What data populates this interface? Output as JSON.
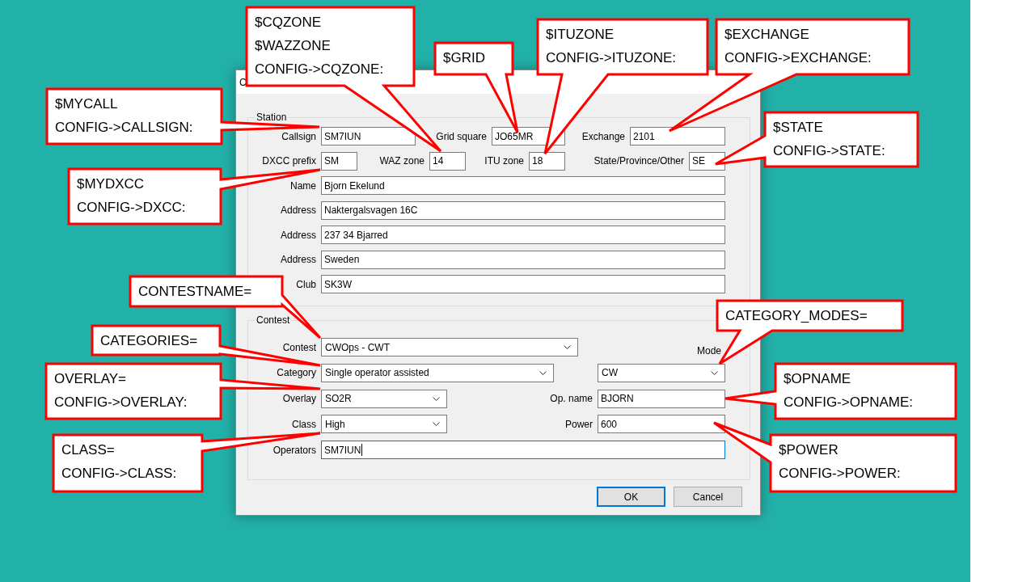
{
  "dialog": {
    "title": "C",
    "station": {
      "title": "Station",
      "fields": [
        {
          "kind": "text",
          "label": "Callsign",
          "value": "SM7IUN",
          "focused": false
        },
        {
          "kind": "text",
          "label": "Grid square",
          "value": "JO65MR",
          "focused": false
        },
        {
          "kind": "text",
          "label": "Exchange",
          "value": "2101",
          "focused": false
        },
        {
          "kind": "text",
          "label": "DXCC prefix",
          "value": "SM",
          "focused": false
        },
        {
          "kind": "text",
          "label": "WAZ zone",
          "value": "14",
          "focused": false
        },
        {
          "kind": "text",
          "label": "ITU zone",
          "value": "18",
          "focused": false
        },
        {
          "kind": "text",
          "label": "State/Province/Other",
          "value": "SE",
          "focused": false
        },
        {
          "kind": "text",
          "label": "Name",
          "value": "Bjorn Ekelund",
          "focused": false
        },
        {
          "kind": "text",
          "label": "Address",
          "value": "Naktergalsvagen 16C",
          "focused": false
        },
        {
          "kind": "text",
          "label": "Address",
          "value": "237 34 Bjarred",
          "focused": false
        },
        {
          "kind": "text",
          "label": "Address",
          "value": "Sweden",
          "focused": false
        },
        {
          "kind": "text",
          "label": "Club",
          "value": "SK3W",
          "focused": false
        }
      ]
    },
    "contest": {
      "title": "Contest",
      "fields": [
        {
          "kind": "combo",
          "label": "Contest",
          "value": "CWOps - CWT",
          "focused": false
        },
        {
          "kind": "caption",
          "text": "Mode"
        },
        {
          "kind": "combo",
          "label": "Category",
          "value": "Single operator assisted",
          "focused": false
        },
        {
          "kind": "combo",
          "value": "CW",
          "focused": false
        },
        {
          "kind": "combo",
          "label": "Overlay",
          "value": "SO2R",
          "focused": false
        },
        {
          "kind": "text",
          "label": "Op. name",
          "value": "BJORN",
          "focused": false
        },
        {
          "kind": "combo",
          "label": "Class",
          "value": "High",
          "focused": false
        },
        {
          "kind": "text",
          "label": "Power",
          "value": "600",
          "focused": false
        },
        {
          "kind": "text",
          "label": "Operators",
          "value": "SM7IUN",
          "focused": true
        }
      ]
    },
    "buttons": [
      {
        "label": "OK",
        "default": true
      },
      {
        "label": "Cancel",
        "default": false
      }
    ]
  },
  "callouts": [
    {
      "lines": [
        "$CQZONE",
        "$WAZZONE",
        "CONFIG->CQZONE:"
      ]
    },
    {
      "lines": [
        "$GRID"
      ]
    },
    {
      "lines": [
        "$ITUZONE",
        "CONFIG->ITUZONE:"
      ]
    },
    {
      "lines": [
        "$EXCHANGE",
        "CONFIG->EXCHANGE:"
      ]
    },
    {
      "lines": [
        "$MYCALL",
        "CONFIG->CALLSIGN:"
      ]
    },
    {
      "lines": [
        "$STATE",
        "CONFIG->STATE:"
      ]
    },
    {
      "lines": [
        "$MYDXCC",
        "CONFIG->DXCC:"
      ]
    },
    {
      "lines": [
        "CONTESTNAME="
      ]
    },
    {
      "lines": [
        "CATEGORY_MODES="
      ]
    },
    {
      "lines": [
        "CATEGORIES="
      ]
    },
    {
      "lines": [
        "OVERLAY=",
        "CONFIG->OVERLAY:"
      ]
    },
    {
      "lines": [
        "$OPNAME",
        "CONFIG->OPNAME:"
      ]
    },
    {
      "lines": [
        "CLASS=",
        "CONFIG->CLASS:"
      ]
    },
    {
      "lines": [
        "$POWER",
        "CONFIG->POWER:"
      ]
    }
  ]
}
